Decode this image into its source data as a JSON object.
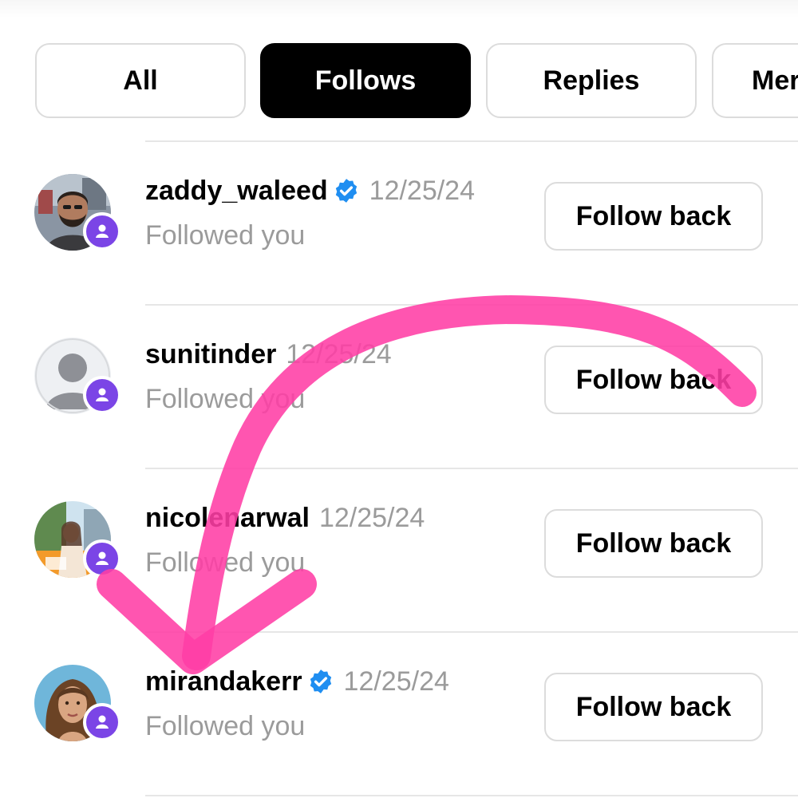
{
  "tabs": [
    {
      "label": "All",
      "active": false
    },
    {
      "label": "Follows",
      "active": true
    },
    {
      "label": "Replies",
      "active": false
    },
    {
      "label": "Mer",
      "active": false
    }
  ],
  "notifications": [
    {
      "username": "zaddy_waleed",
      "verified": true,
      "date": "12/25/24",
      "subtext": "Followed you",
      "button": "Follow back",
      "avatar": "photo-man-beard"
    },
    {
      "username": "sunitinder",
      "verified": false,
      "date": "12/25/24",
      "subtext": "Followed you",
      "button": "Follow back",
      "avatar": "default-person"
    },
    {
      "username": "nicolenarwal",
      "verified": false,
      "date": "12/25/24",
      "subtext": "Followed you",
      "button": "Follow back",
      "avatar": "photo-woman-outdoor"
    },
    {
      "username": "mirandakerr",
      "verified": true,
      "date": "12/25/24",
      "subtext": "Followed you",
      "button": "Follow back",
      "avatar": "photo-woman-portrait"
    }
  ],
  "colors": {
    "badge": "#7b45e6",
    "verified": "#1f8ef1",
    "secondary_text": "#9b9b9b",
    "annotation": "#ff3ea5"
  },
  "annotation": {
    "type": "hand-drawn-arrow",
    "color": "#ff3ea5"
  }
}
